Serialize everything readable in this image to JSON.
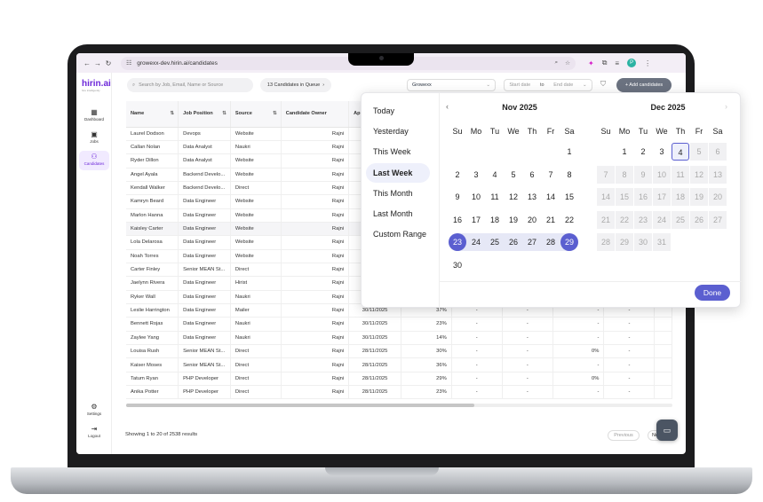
{
  "browser": {
    "url": "growexx-dev.hirin.ai/candidates",
    "profile_initial": "P"
  },
  "app": {
    "logo": "hirin.ai",
    "logo_tagline": "hire intelligently"
  },
  "sidebar": {
    "items": [
      {
        "label": "Dashboard",
        "icon": "dashboard-icon"
      },
      {
        "label": "Jobs",
        "icon": "briefcase-icon"
      },
      {
        "label": "Candidates",
        "icon": "people-icon"
      }
    ],
    "bottom": [
      {
        "label": "Settings",
        "icon": "gear-icon"
      },
      {
        "label": "Logout",
        "icon": "logout-icon"
      }
    ]
  },
  "toolbar": {
    "search_placeholder": "Search by Job, Email, Name or Source",
    "queue_label": "13 Candidates in Queue",
    "workspace": "Growexx",
    "start_placeholder": "Start date",
    "to_label": "to",
    "end_placeholder": "End date",
    "add_button": "+ Add candidates"
  },
  "table": {
    "columns": [
      "Name",
      "Job Position",
      "Source",
      "Candidate Owner",
      "Ap"
    ],
    "rows": [
      {
        "name": "Laurel Dodson",
        "job": "Devops",
        "source": "Website",
        "owner": "Rajni",
        "date": "",
        "score": "",
        "a": "",
        "b": "",
        "c": "",
        "d": ""
      },
      {
        "name": "Callan Nolan",
        "job": "Data Analyst",
        "source": "Naukri",
        "owner": "Rajni",
        "date": "",
        "score": "",
        "a": "",
        "b": "",
        "c": "",
        "d": ""
      },
      {
        "name": "Ryder Dillon",
        "job": "Data Analyst",
        "source": "Website",
        "owner": "Rajni",
        "date": "",
        "score": "",
        "a": "",
        "b": "",
        "c": "",
        "d": ""
      },
      {
        "name": "Angel Ayala",
        "job": "Backend Develo...",
        "source": "Website",
        "owner": "Rajni",
        "date": "",
        "score": "",
        "a": "",
        "b": "",
        "c": "",
        "d": ""
      },
      {
        "name": "Kendall Walker",
        "job": "Backend Develo...",
        "source": "Direct",
        "owner": "Rajni",
        "date": "",
        "score": "",
        "a": "",
        "b": "",
        "c": "",
        "d": ""
      },
      {
        "name": "Kamryn Beard",
        "job": "Data Engineer",
        "source": "Website",
        "owner": "Rajni",
        "date": "",
        "score": "",
        "a": "",
        "b": "",
        "c": "",
        "d": ""
      },
      {
        "name": "Marlon Hanna",
        "job": "Data Engineer",
        "source": "Website",
        "owner": "Rajni",
        "date": "",
        "score": "",
        "a": "",
        "b": "",
        "c": "",
        "d": ""
      },
      {
        "name": "Kaisley Carter",
        "job": "Data Engineer",
        "source": "Website",
        "owner": "Rajni",
        "date": "",
        "score": "",
        "a": "",
        "b": "",
        "c": "",
        "d": ""
      },
      {
        "name": "Lola Delarosa",
        "job": "Data Engineer",
        "source": "Website",
        "owner": "Rajni",
        "date": "",
        "score": "",
        "a": "",
        "b": "",
        "c": "",
        "d": ""
      },
      {
        "name": "Noah Torres",
        "job": "Data Engineer",
        "source": "Website",
        "owner": "Rajni",
        "date": "",
        "score": "",
        "a": "",
        "b": "",
        "c": "",
        "d": ""
      },
      {
        "name": "Carter Finley",
        "job": "Senior MEAN St...",
        "source": "Direct",
        "owner": "Rajni",
        "date": "",
        "score": "",
        "a": "",
        "b": "",
        "c": "",
        "d": ""
      },
      {
        "name": "Jaelynn Rivera",
        "job": "Data Engineer",
        "source": "Hirist",
        "owner": "Rajni",
        "date": "",
        "score": "",
        "a": "",
        "b": "",
        "c": "",
        "d": ""
      },
      {
        "name": "Ryker Wall",
        "job": "Data Engineer",
        "source": "Naukri",
        "owner": "Rajni",
        "date": "",
        "score": "",
        "a": "",
        "b": "",
        "c": "",
        "d": ""
      },
      {
        "name": "Leslie Harrington",
        "job": "Data Engineer",
        "source": "Mailer",
        "owner": "Rajni",
        "date": "30/11/2025",
        "score": "37%",
        "a": "-",
        "b": "-",
        "c": "-",
        "d": "-"
      },
      {
        "name": "Bennett Rojas",
        "job": "Data Engineer",
        "source": "Naukri",
        "owner": "Rajni",
        "date": "30/11/2025",
        "score": "23%",
        "a": "-",
        "b": "-",
        "c": "-",
        "d": "-"
      },
      {
        "name": "Zaylee Yang",
        "job": "Data Engineer",
        "source": "Naukri",
        "owner": "Rajni",
        "date": "30/11/2025",
        "score": "14%",
        "a": "-",
        "b": "-",
        "c": "-",
        "d": "-"
      },
      {
        "name": "Louisa Rush",
        "job": "Senior MEAN St...",
        "source": "Direct",
        "owner": "Rajni",
        "date": "28/11/2025",
        "score": "30%",
        "a": "-",
        "b": "-",
        "c": "0%",
        "d": "-"
      },
      {
        "name": "Kaiser Moses",
        "job": "Senior MEAN St...",
        "source": "Direct",
        "owner": "Rajni",
        "date": "28/11/2025",
        "score": "36%",
        "a": "-",
        "b": "-",
        "c": "-",
        "d": "-"
      },
      {
        "name": "Tatum Ryan",
        "job": "PHP Developer",
        "source": "Direct",
        "owner": "Rajni",
        "date": "28/11/2025",
        "score": "29%",
        "a": "-",
        "b": "-",
        "c": "0%",
        "d": "-"
      },
      {
        "name": "Anika Potter",
        "job": "PHP Developer",
        "source": "Direct",
        "owner": "Rajni",
        "date": "28/11/2025",
        "score": "23%",
        "a": "-",
        "b": "-",
        "c": "-",
        "d": "-"
      }
    ]
  },
  "footer": {
    "showing": "Showing 1 to 20 of 2538 results",
    "prev": "Previous",
    "next": "Ne"
  },
  "picker": {
    "presets": [
      "Today",
      "Yesterday",
      "This Week",
      "Last Week",
      "This Month",
      "Last Month",
      "Custom Range"
    ],
    "selected_preset": "Last Week",
    "weekdays": [
      "Su",
      "Mo",
      "Tu",
      "We",
      "Th",
      "Fr",
      "Sa"
    ],
    "months": [
      {
        "title": "Nov  2025",
        "first_weekday": 6,
        "days": 30,
        "disabled_from": null
      },
      {
        "title": "Dec  2025",
        "first_weekday": 1,
        "days": 31,
        "disabled_from": 5
      }
    ],
    "range_start": 23,
    "range_end": 29,
    "today_marker": 4,
    "done_label": "Done",
    "accent_color": "#5b5fd0"
  }
}
